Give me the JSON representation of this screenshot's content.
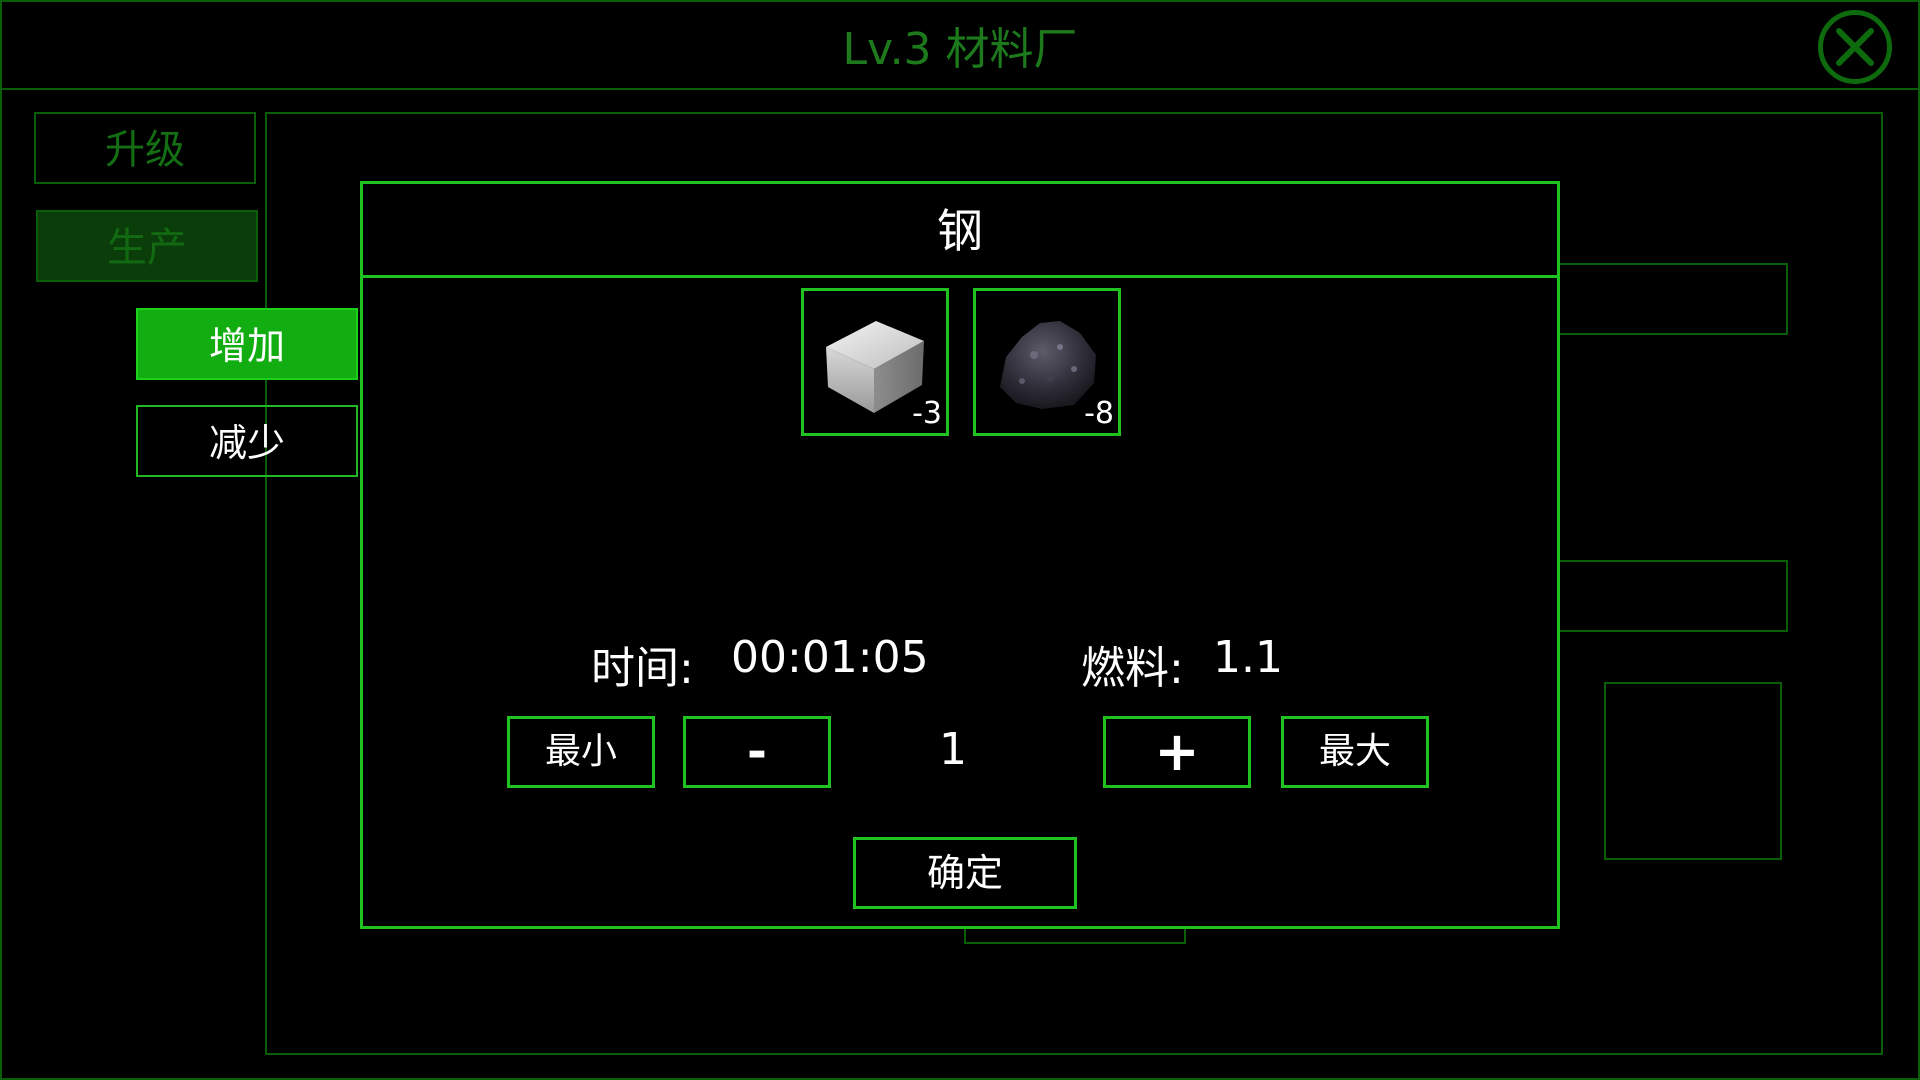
{
  "window": {
    "title": "Lv.3 材料厂",
    "close_icon": "close-icon"
  },
  "sidebar": {
    "upgrade_label": "升级",
    "produce_label": "生产"
  },
  "actions": {
    "add_label": "增加",
    "reduce_label": "减少"
  },
  "dialog": {
    "title": "钢",
    "materials": [
      {
        "icon": "steel-block-icon",
        "count": "-3"
      },
      {
        "icon": "coal-ore-icon",
        "count": "-8"
      }
    ],
    "time_label": "时间:",
    "time_value": "00:01:05",
    "fuel_label": "燃料:",
    "fuel_value": "1.1",
    "min_label": "最小",
    "minus_label": "-",
    "quantity": "1",
    "plus_label": "+",
    "max_label": "最大",
    "confirm_label": "确定"
  },
  "colors": {
    "accent_bright": "#1fc21f",
    "accent_dim": "#0a5e0a",
    "button_active": "#11ad11"
  }
}
